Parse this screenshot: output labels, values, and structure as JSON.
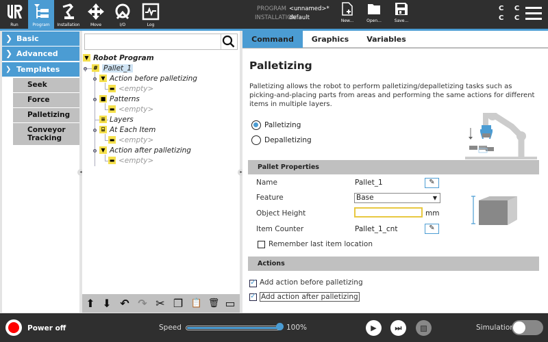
{
  "topbar": {
    "nav": [
      {
        "label": "Run",
        "icon": "ur-logo-icon",
        "active": false
      },
      {
        "label": "Program",
        "icon": "program-tree-icon",
        "active": true
      },
      {
        "label": "Installation",
        "icon": "robot-arm-icon",
        "active": false
      },
      {
        "label": "Move",
        "icon": "move-arrows-icon",
        "active": false
      },
      {
        "label": "I/O",
        "icon": "io-icon",
        "active": false
      },
      {
        "label": "Log",
        "icon": "log-icon",
        "active": false
      }
    ],
    "program_label": "PROGRAM",
    "program_value": "<unnamed>*",
    "installation_label": "INSTALLATION",
    "installation_value": "default",
    "file_buttons": [
      {
        "label": "New...",
        "icon": "new-file-icon"
      },
      {
        "label": "Open...",
        "icon": "folder-icon"
      },
      {
        "label": "Save...",
        "icon": "save-icon"
      }
    ],
    "cc_line1": "C C",
    "cc_line2": "C C"
  },
  "sidebar": {
    "categories": [
      {
        "label": "Basic",
        "expanded": false,
        "chevron": "›"
      },
      {
        "label": "Advanced",
        "expanded": false,
        "chevron": "›"
      },
      {
        "label": "Templates",
        "expanded": true,
        "chevron": "⌄"
      }
    ],
    "templates": [
      {
        "label": "Seek"
      },
      {
        "label": "Force"
      },
      {
        "label": "Palletizing"
      },
      {
        "label": "Conveyor Tracking"
      }
    ]
  },
  "tree": {
    "search_placeholder": "",
    "root": "Robot Program",
    "nodes": [
      {
        "label": "Pallet_1",
        "icon": "grid-icon",
        "glyph": "#",
        "selected": true
      },
      {
        "label": "Action before palletizing",
        "icon": "triangle-down-icon",
        "glyph": "▼"
      },
      {
        "label": "<empty>",
        "icon": "empty-icon",
        "glyph": "▬"
      },
      {
        "label": "Patterns",
        "icon": "folder-icon",
        "glyph": "■"
      },
      {
        "label": "<empty>",
        "icon": "empty-icon",
        "glyph": "▬"
      },
      {
        "label": "Layers",
        "icon": "layers-icon",
        "glyph": "≡"
      },
      {
        "label": "At Each Item",
        "icon": "item-icon",
        "glyph": "⌸"
      },
      {
        "label": "<empty>",
        "icon": "empty-icon",
        "glyph": "▬"
      },
      {
        "label": "Action after palletizing",
        "icon": "triangle-down-icon",
        "glyph": "▼"
      },
      {
        "label": "<empty>",
        "icon": "empty-icon",
        "glyph": "▬"
      }
    ],
    "tools": [
      {
        "name": "move-up",
        "glyph": "⬆"
      },
      {
        "name": "move-down",
        "glyph": "⬇"
      },
      {
        "name": "undo",
        "glyph": "↶"
      },
      {
        "name": "redo",
        "glyph": "↷"
      },
      {
        "name": "cut",
        "glyph": "✂"
      },
      {
        "name": "copy",
        "glyph": "❐"
      },
      {
        "name": "paste",
        "glyph": "📋"
      },
      {
        "name": "delete",
        "glyph": "🗑"
      },
      {
        "name": "suppress",
        "glyph": "▭"
      }
    ]
  },
  "main": {
    "tabs": [
      {
        "label": "Command",
        "active": true
      },
      {
        "label": "Graphics",
        "active": false
      },
      {
        "label": "Variables",
        "active": false
      }
    ],
    "title": "Palletizing",
    "description": "Palletizing allows the robot to perform palletizing/depalletizing tasks such as picking-and-placing parts from areas and performing the same actions for different items in multiple layers.",
    "mode_options": [
      {
        "label": "Palletizing",
        "selected": true
      },
      {
        "label": "Depalletizing",
        "selected": false
      }
    ],
    "pallet_properties": {
      "header": "Pallet Properties",
      "name_label": "Name",
      "name_value": "Pallet_1",
      "feature_label": "Feature",
      "feature_value": "Base",
      "height_label": "Object Height",
      "height_value": "",
      "height_unit": "mm",
      "counter_label": "Item Counter",
      "counter_value": "Pallet_1_cnt",
      "remember_label": "Remember last item location",
      "remember_checked": false
    },
    "actions": {
      "header": "Actions",
      "items": [
        {
          "label": "Add action before palletizing",
          "checked": true
        },
        {
          "label": "Add action after palletizing",
          "checked": true
        }
      ]
    }
  },
  "bottombar": {
    "power_label": "Power off",
    "speed_label": "Speed",
    "speed_value": "100%",
    "speed_fraction": 1.0,
    "simulation_label": "Simulation",
    "simulation_on": false
  },
  "colors": {
    "accent": "#4b9cd3",
    "bar_bg": "#2f2f2f",
    "tree_icon": "#f5e04c",
    "power": "#ff0000"
  }
}
